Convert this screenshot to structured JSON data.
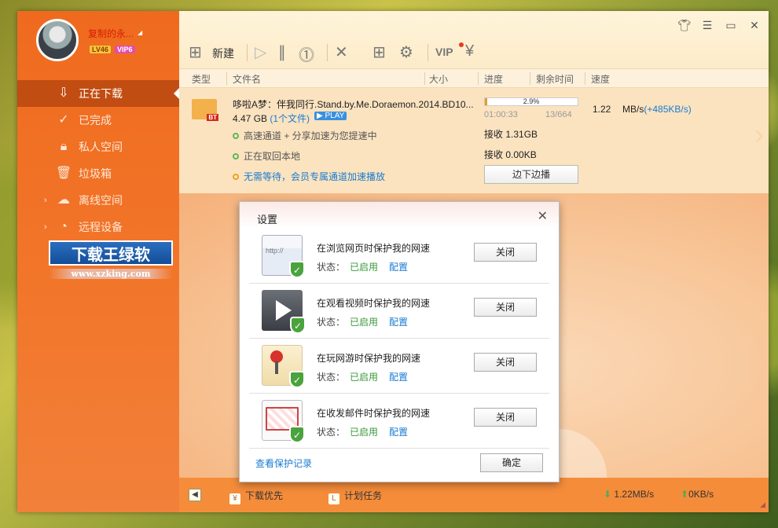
{
  "user": {
    "name": "复制的永...",
    "level": "LV46",
    "vip": "VIP6"
  },
  "sidebar": {
    "items": [
      {
        "label": "正在下载",
        "icon": "download-arrow-icon",
        "active": true
      },
      {
        "label": "已完成",
        "icon": "check-circle-icon"
      },
      {
        "label": "私人空间",
        "icon": "lock-icon"
      },
      {
        "label": "垃圾箱",
        "icon": "trash-icon"
      },
      {
        "label": "离线空间",
        "icon": "cloud-icon",
        "expandable": true
      },
      {
        "label": "远程设备",
        "icon": "remote-device-icon",
        "expandable": true
      }
    ]
  },
  "watermark": {
    "title": "下载王绿软",
    "url": "www.xzking.com"
  },
  "toolbar": {
    "new_label": "新建",
    "vip_label": "VIP"
  },
  "columns": {
    "type": "类型",
    "filename": "文件名",
    "size": "大小",
    "progress": "进度",
    "remaining": "剩余时间",
    "speed": "速度"
  },
  "task": {
    "name": "哆啦A梦：伴我同行.Stand.by.Me.Doraemon.2014.BD10...",
    "size": "4.47 GB",
    "file_count": "(1个文件)",
    "play_badge": "PLAY",
    "bt_badge": "BT",
    "line1": "高速通道 + 分享加速为您提速中",
    "line2": "正在取回本地",
    "line3": "无需等待，会员专属通道加速播放",
    "progress_pct": "2.9%",
    "progress_value": 0.029,
    "elapsed": "01:00:33",
    "pieces": "13/664",
    "speed": "1.22",
    "speed_unit": "MB/s",
    "speed_bonus": "(+485KB/s)",
    "recv1": "接收 1.31GB",
    "recv2": "接收 0.00KB",
    "play_button": "边下边播"
  },
  "dialog": {
    "title": "设置",
    "status_label": "状态：",
    "status_on": "已启用",
    "config_label": "配置",
    "options": [
      {
        "title": "在浏览网页时保护我的网速",
        "button": "关闭",
        "icon": "web-browser-icon"
      },
      {
        "title": "在观看视频时保护我的网速",
        "button": "关闭",
        "icon": "video-play-icon"
      },
      {
        "title": "在玩网游时保护我的网速",
        "button": "关闭",
        "icon": "joystick-icon"
      },
      {
        "title": "在收发邮件时保护我的网速",
        "button": "关闭",
        "icon": "mail-envelope-icon"
      }
    ],
    "history_link": "查看保护记录",
    "ok_button": "确定",
    "web_url_text": "http://"
  },
  "statusbar": {
    "priority": "下载优先",
    "scheduled": "计划任务",
    "down_speed": "1.22MB/s",
    "up_speed": "0KB/s"
  }
}
